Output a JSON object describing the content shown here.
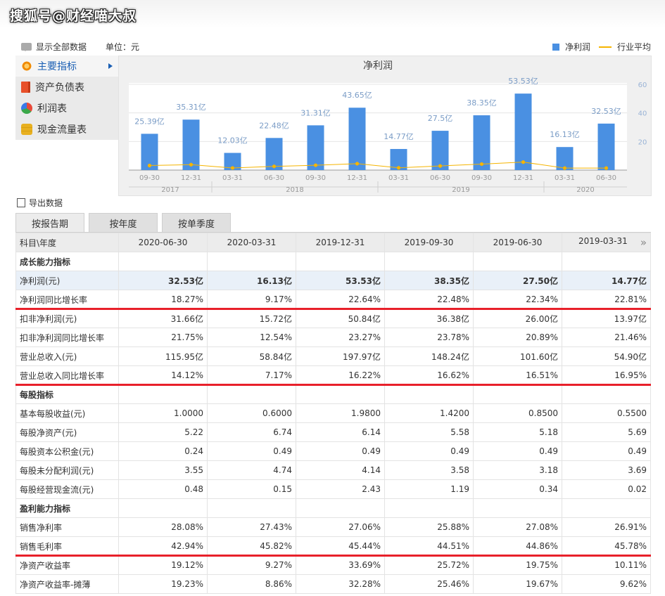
{
  "watermark": "搜狐号@财经喵大叔",
  "toolbar": {
    "show_all": "显示全部数据",
    "unit": "单位：元"
  },
  "legend": {
    "net_profit": "净利润",
    "industry_avg": "行业平均"
  },
  "sidebar": {
    "items": [
      {
        "label": "主要指标",
        "icon": "flower-icon",
        "active": true
      },
      {
        "label": "资产负债表",
        "icon": "document-icon"
      },
      {
        "label": "利润表",
        "icon": "pie-chart-icon"
      },
      {
        "label": "现金流量表",
        "icon": "coins-icon"
      }
    ]
  },
  "chart_data": {
    "type": "bar",
    "title": "净利润",
    "categories": [
      "09-30",
      "12-31",
      "03-31",
      "06-30",
      "09-30",
      "12-31",
      "03-31",
      "06-30",
      "09-30",
      "12-31",
      "03-31",
      "06-30"
    ],
    "years": [
      {
        "label": "2017",
        "span": [
          0,
          1
        ]
      },
      {
        "label": "2018",
        "span": [
          2,
          5
        ]
      },
      {
        "label": "2019",
        "span": [
          6,
          9
        ]
      },
      {
        "label": "2020",
        "span": [
          10,
          11
        ]
      }
    ],
    "series": [
      {
        "name": "净利润",
        "values": [
          25.39,
          35.31,
          12.03,
          22.48,
          31.31,
          43.65,
          14.77,
          27.5,
          38.35,
          53.53,
          16.13,
          32.53
        ],
        "labels": [
          "25.39亿",
          "35.31亿",
          "12.03亿",
          "22.48亿",
          "31.31亿",
          "43.65亿",
          "14.77亿",
          "27.5亿",
          "38.35亿",
          "53.53亿",
          "16.13亿",
          "32.53亿"
        ]
      },
      {
        "name": "行业平均",
        "values": [
          3.2,
          3.8,
          1.5,
          2.6,
          3.4,
          4.5,
          1.6,
          2.9,
          4.2,
          5.6,
          1.4,
          1.4
        ]
      }
    ],
    "y_ticks": [
      20,
      40,
      60
    ],
    "ylim": [
      0,
      60
    ],
    "colors": {
      "bar": "#4a90e2",
      "line": "#f5b400",
      "label": "#7a9cc6"
    }
  },
  "export_label": "导出数据",
  "tabs": [
    {
      "label": "按报告期",
      "active": true
    },
    {
      "label": "按年度"
    },
    {
      "label": "按单季度"
    }
  ],
  "table": {
    "header_label": "科目\\年度",
    "columns": [
      "2020-06-30",
      "2020-03-31",
      "2019-12-31",
      "2019-09-30",
      "2019-06-30",
      "2019-03-31"
    ],
    "rows": [
      {
        "kind": "section",
        "label": "成长能力指标"
      },
      {
        "kind": "highlight",
        "label": "净利润(元)",
        "values": [
          "32.53亿",
          "16.13亿",
          "53.53亿",
          "38.35亿",
          "27.50亿",
          "14.77亿"
        ]
      },
      {
        "label": "净利润同比增长率",
        "values": [
          "18.27%",
          "9.17%",
          "22.64%",
          "22.48%",
          "22.34%",
          "22.81%"
        ]
      },
      {
        "label": "扣非净利润(元)",
        "values": [
          "31.66亿",
          "15.72亿",
          "50.84亿",
          "36.38亿",
          "26.00亿",
          "13.97亿"
        ]
      },
      {
        "label": "扣非净利润同比增长率",
        "values": [
          "21.75%",
          "12.54%",
          "23.27%",
          "23.78%",
          "20.89%",
          "21.46%"
        ]
      },
      {
        "label": "营业总收入(元)",
        "values": [
          "115.95亿",
          "58.84亿",
          "197.97亿",
          "148.24亿",
          "101.60亿",
          "54.90亿"
        ]
      },
      {
        "label": "营业总收入同比增长率",
        "values": [
          "14.12%",
          "7.17%",
          "16.22%",
          "16.62%",
          "16.51%",
          "16.95%"
        ]
      },
      {
        "kind": "section",
        "label": "每股指标"
      },
      {
        "label": "基本每股收益(元)",
        "values": [
          "1.0000",
          "0.6000",
          "1.9800",
          "1.4200",
          "0.8500",
          "0.5500"
        ]
      },
      {
        "label": "每股净资产(元)",
        "values": [
          "5.22",
          "6.74",
          "6.14",
          "5.58",
          "5.18",
          "5.69"
        ]
      },
      {
        "label": "每股资本公积金(元)",
        "values": [
          "0.24",
          "0.49",
          "0.49",
          "0.49",
          "0.49",
          "0.49"
        ]
      },
      {
        "label": "每股未分配利润(元)",
        "values": [
          "3.55",
          "4.74",
          "4.14",
          "3.58",
          "3.18",
          "3.69"
        ]
      },
      {
        "label": "每股经营现金流(元)",
        "values": [
          "0.48",
          "0.15",
          "2.43",
          "1.19",
          "0.34",
          "0.02"
        ]
      },
      {
        "kind": "section",
        "label": "盈利能力指标"
      },
      {
        "label": "销售净利率",
        "values": [
          "28.08%",
          "27.43%",
          "27.06%",
          "25.88%",
          "27.08%",
          "26.91%"
        ]
      },
      {
        "label": "销售毛利率",
        "values": [
          "42.94%",
          "45.82%",
          "45.44%",
          "44.51%",
          "44.86%",
          "45.78%"
        ]
      },
      {
        "label": "净资产收益率",
        "values": [
          "19.12%",
          "9.27%",
          "33.69%",
          "25.72%",
          "19.75%",
          "10.11%"
        ]
      },
      {
        "label": "净资产收益率-摊薄",
        "values": [
          "19.23%",
          "8.86%",
          "32.28%",
          "25.46%",
          "19.67%",
          "9.62%"
        ]
      }
    ]
  },
  "annotations": {
    "red_line_color": "#e8202a",
    "red_lines_after_rows": [
      2,
      6,
      15
    ]
  }
}
